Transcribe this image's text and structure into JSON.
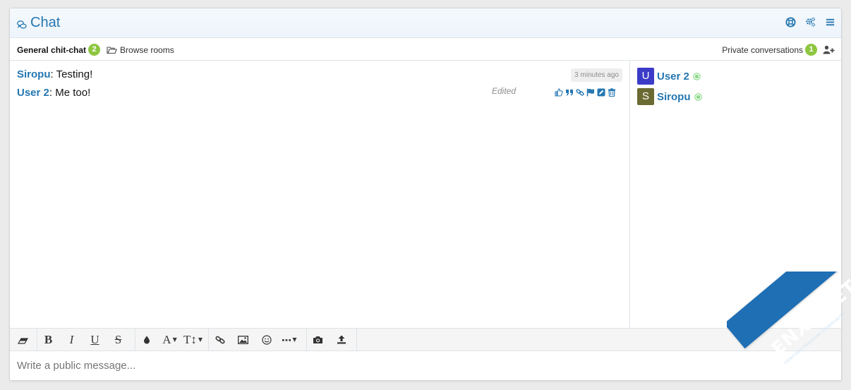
{
  "header": {
    "title": "Chat",
    "tools": [
      "help-icon",
      "settings-icon",
      "menu-icon"
    ]
  },
  "tabs": {
    "room_name": "General chit-chat",
    "room_count": "2",
    "browse_label": "Browse rooms",
    "private_label": "Private conversations",
    "private_count": "1"
  },
  "messages": [
    {
      "author": "Siropu",
      "text": ": Testing!",
      "time": "3 minutes ago"
    },
    {
      "author": "User 2",
      "text": ": Me too!",
      "status": "Edited"
    }
  ],
  "message_actions": [
    "like-icon",
    "quote-icon",
    "link-icon",
    "report-icon",
    "edit-icon",
    "delete-icon"
  ],
  "users": [
    {
      "initial": "U",
      "name": "User 2",
      "avatar_color": "#3b3bc7",
      "online": true
    },
    {
      "initial": "S",
      "name": "Siropu",
      "avatar_color": "#6b6a32",
      "online": true
    }
  ],
  "editor_tools": [
    "eraser",
    "bold",
    "italic",
    "underline",
    "strikethrough",
    "text-color",
    "font-family",
    "font-size",
    "link",
    "image",
    "smilie",
    "more",
    "camera",
    "upload"
  ],
  "composer": {
    "placeholder": "Write a public message..."
  },
  "watermark": {
    "text": "ENXF.NET",
    "subtitle": "XENFORO PREMIUM COMMUNITY"
  },
  "colors": {
    "accent": "#2577b1",
    "badge": "#8dc63f",
    "online": "#8dd98d"
  }
}
